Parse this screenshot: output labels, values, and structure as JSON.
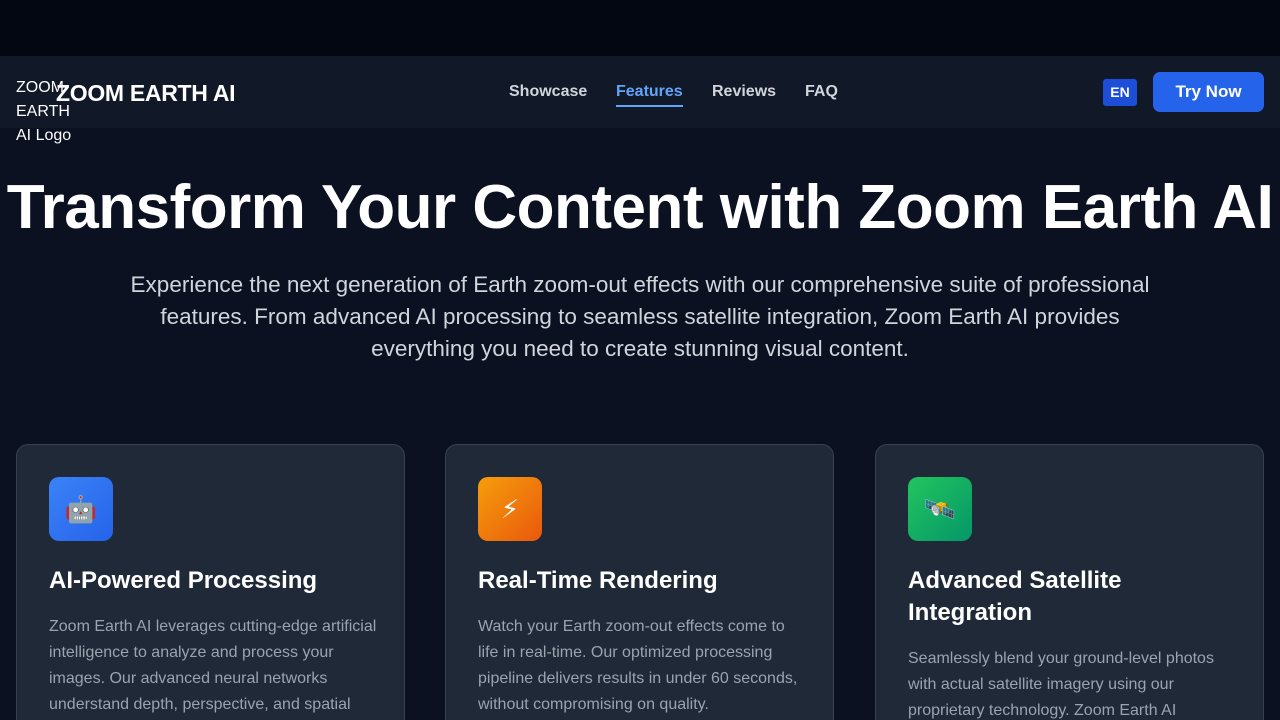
{
  "header": {
    "logo_alt": "ZOOM EARTH AI Logo",
    "brand": "ZOOM EARTH AI",
    "nav": [
      {
        "label": "Showcase",
        "active": false
      },
      {
        "label": "Features",
        "active": true
      },
      {
        "label": "Reviews",
        "active": false
      },
      {
        "label": "FAQ",
        "active": false
      }
    ],
    "language": "EN",
    "cta": "Try Now"
  },
  "hero": {
    "title": "Transform Your Content with Zoom Earth AI",
    "subtitle": "Experience the next generation of Earth zoom-out effects with our comprehensive suite of professional features. From advanced AI processing to seamless satellite integration, Zoom Earth AI provides everything you need to create stunning visual content."
  },
  "features": [
    {
      "icon": "robot-icon",
      "glyph": "🤖",
      "color": "#3b82f6",
      "title": "AI-Powered Processing",
      "description": "Zoom Earth AI leverages cutting-edge artificial intelligence to analyze and process your images. Our advanced neural networks understand depth, perspective, and spatial"
    },
    {
      "icon": "lightning-icon",
      "glyph": "⚡",
      "color": "#f59e0b",
      "title": "Real-Time Rendering",
      "description": "Watch your Earth zoom-out effects come to life in real-time. Our optimized processing pipeline delivers results in under 60 seconds, without compromising on quality."
    },
    {
      "icon": "satellite-icon",
      "glyph": "🛰️",
      "color": "#10b981",
      "title": "Advanced Satellite Integration",
      "description": "Seamlessly blend your ground-level photos with actual satellite imagery using our proprietary technology. Zoom Earth AI"
    }
  ]
}
